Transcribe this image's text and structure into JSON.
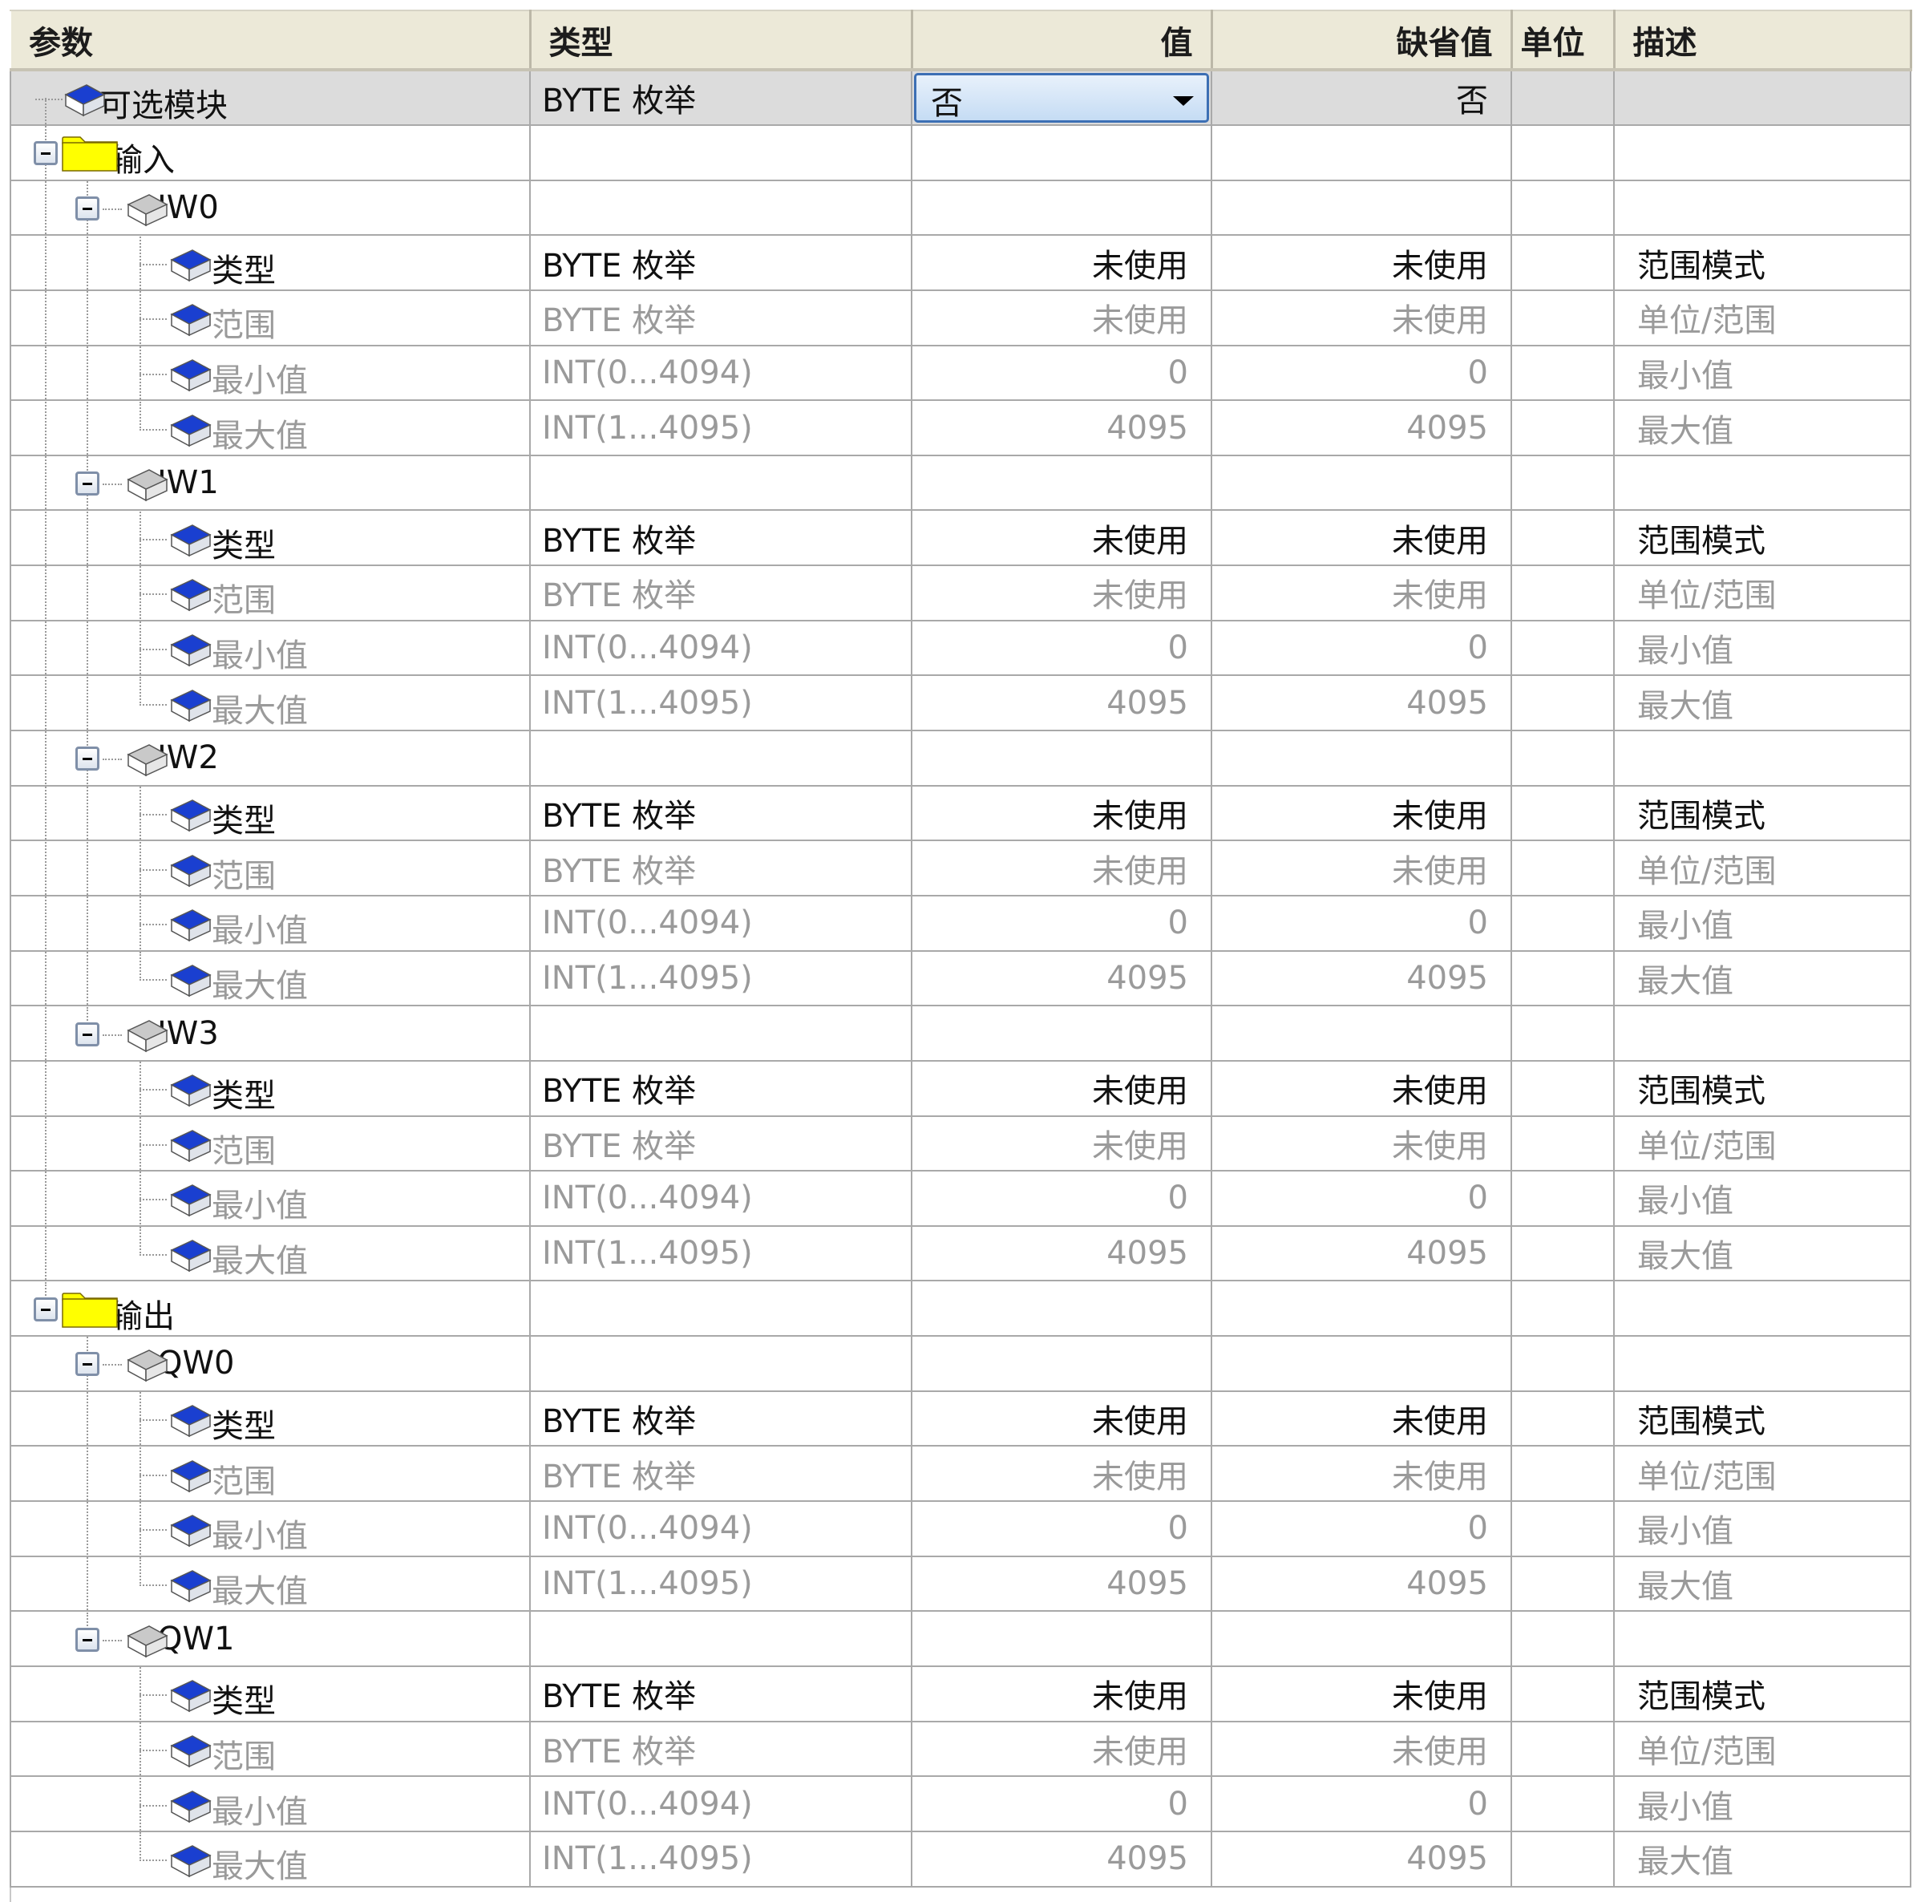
{
  "columns": [
    {
      "label": "参数",
      "align": "left"
    },
    {
      "label": "类型",
      "align": "left"
    },
    {
      "label": "值",
      "align": "right"
    },
    {
      "label": "缺省值",
      "align": "right"
    },
    {
      "label": "单位",
      "align": "left"
    },
    {
      "label": "描述",
      "align": "left"
    }
  ],
  "colors": {
    "header_bg": "#ece9d8",
    "selected_row": "#dcdcdc",
    "disabled_text": "#9a9a9a",
    "dropdown_border": "#3c6fb4",
    "folder": "#ffff00",
    "param_icon": "#1a3fd0"
  },
  "rows": [
    {
      "kind": "param",
      "level": 0,
      "name": "可选模块",
      "type": "BYTE 枚举",
      "value": "否",
      "default": "否",
      "unit": "",
      "desc": "",
      "selected": true,
      "dropdown": true,
      "icon": "blue-block-icon"
    },
    {
      "kind": "folder",
      "level": 0,
      "name": "输入",
      "icon": "folder-icon"
    },
    {
      "kind": "channel",
      "level": 1,
      "name": "IW0",
      "icon": "gray-block-icon"
    },
    {
      "kind": "param",
      "level": 2,
      "name": "类型",
      "type": "BYTE 枚举",
      "value": "未使用",
      "default": "未使用",
      "unit": "",
      "desc": "范围模式",
      "icon": "blue-block-icon"
    },
    {
      "kind": "param",
      "level": 2,
      "name": "范围",
      "type": "BYTE 枚举",
      "value": "未使用",
      "default": "未使用",
      "unit": "",
      "desc": "单位/范围",
      "disabled": true,
      "icon": "blue-block-icon"
    },
    {
      "kind": "param",
      "level": 2,
      "name": "最小值",
      "type": "INT(0...4094)",
      "value": "0",
      "default": "0",
      "unit": "",
      "desc": "最小值",
      "disabled": true,
      "icon": "blue-block-icon"
    },
    {
      "kind": "param",
      "level": 2,
      "name": "最大值",
      "type": "INT(1...4095)",
      "value": "4095",
      "default": "4095",
      "unit": "",
      "desc": "最大值",
      "disabled": true,
      "last": true,
      "icon": "blue-block-icon"
    },
    {
      "kind": "channel",
      "level": 1,
      "name": "IW1",
      "icon": "gray-block-icon"
    },
    {
      "kind": "param",
      "level": 2,
      "name": "类型",
      "type": "BYTE 枚举",
      "value": "未使用",
      "default": "未使用",
      "unit": "",
      "desc": "范围模式",
      "icon": "blue-block-icon"
    },
    {
      "kind": "param",
      "level": 2,
      "name": "范围",
      "type": "BYTE 枚举",
      "value": "未使用",
      "default": "未使用",
      "unit": "",
      "desc": "单位/范围",
      "disabled": true,
      "icon": "blue-block-icon"
    },
    {
      "kind": "param",
      "level": 2,
      "name": "最小值",
      "type": "INT(0...4094)",
      "value": "0",
      "default": "0",
      "unit": "",
      "desc": "最小值",
      "disabled": true,
      "icon": "blue-block-icon"
    },
    {
      "kind": "param",
      "level": 2,
      "name": "最大值",
      "type": "INT(1...4095)",
      "value": "4095",
      "default": "4095",
      "unit": "",
      "desc": "最大值",
      "disabled": true,
      "last": true,
      "icon": "blue-block-icon"
    },
    {
      "kind": "channel",
      "level": 1,
      "name": "IW2",
      "icon": "gray-block-icon"
    },
    {
      "kind": "param",
      "level": 2,
      "name": "类型",
      "type": "BYTE 枚举",
      "value": "未使用",
      "default": "未使用",
      "unit": "",
      "desc": "范围模式",
      "icon": "blue-block-icon"
    },
    {
      "kind": "param",
      "level": 2,
      "name": "范围",
      "type": "BYTE 枚举",
      "value": "未使用",
      "default": "未使用",
      "unit": "",
      "desc": "单位/范围",
      "disabled": true,
      "icon": "blue-block-icon"
    },
    {
      "kind": "param",
      "level": 2,
      "name": "最小值",
      "type": "INT(0...4094)",
      "value": "0",
      "default": "0",
      "unit": "",
      "desc": "最小值",
      "disabled": true,
      "icon": "blue-block-icon"
    },
    {
      "kind": "param",
      "level": 2,
      "name": "最大值",
      "type": "INT(1...4095)",
      "value": "4095",
      "default": "4095",
      "unit": "",
      "desc": "最大值",
      "disabled": true,
      "last": true,
      "icon": "blue-block-icon"
    },
    {
      "kind": "channel",
      "level": 1,
      "name": "IW3",
      "last": true,
      "icon": "gray-block-icon"
    },
    {
      "kind": "param",
      "level": 2,
      "name": "类型",
      "type": "BYTE 枚举",
      "value": "未使用",
      "default": "未使用",
      "unit": "",
      "desc": "范围模式",
      "icon": "blue-block-icon"
    },
    {
      "kind": "param",
      "level": 2,
      "name": "范围",
      "type": "BYTE 枚举",
      "value": "未使用",
      "default": "未使用",
      "unit": "",
      "desc": "单位/范围",
      "disabled": true,
      "icon": "blue-block-icon"
    },
    {
      "kind": "param",
      "level": 2,
      "name": "最小值",
      "type": "INT(0...4094)",
      "value": "0",
      "default": "0",
      "unit": "",
      "desc": "最小值",
      "disabled": true,
      "icon": "blue-block-icon"
    },
    {
      "kind": "param",
      "level": 2,
      "name": "最大值",
      "type": "INT(1...4095)",
      "value": "4095",
      "default": "4095",
      "unit": "",
      "desc": "最大值",
      "disabled": true,
      "last": true,
      "icon": "blue-block-icon"
    },
    {
      "kind": "folder",
      "level": 0,
      "name": "输出",
      "icon": "folder-icon"
    },
    {
      "kind": "channel",
      "level": 1,
      "name": "QW0",
      "icon": "gray-block-icon"
    },
    {
      "kind": "param",
      "level": 2,
      "name": "类型",
      "type": "BYTE 枚举",
      "value": "未使用",
      "default": "未使用",
      "unit": "",
      "desc": "范围模式",
      "icon": "blue-block-icon"
    },
    {
      "kind": "param",
      "level": 2,
      "name": "范围",
      "type": "BYTE 枚举",
      "value": "未使用",
      "default": "未使用",
      "unit": "",
      "desc": "单位/范围",
      "disabled": true,
      "icon": "blue-block-icon"
    },
    {
      "kind": "param",
      "level": 2,
      "name": "最小值",
      "type": "INT(0...4094)",
      "value": "0",
      "default": "0",
      "unit": "",
      "desc": "最小值",
      "disabled": true,
      "icon": "blue-block-icon"
    },
    {
      "kind": "param",
      "level": 2,
      "name": "最大值",
      "type": "INT(1...4095)",
      "value": "4095",
      "default": "4095",
      "unit": "",
      "desc": "最大值",
      "disabled": true,
      "last": true,
      "icon": "blue-block-icon"
    },
    {
      "kind": "channel",
      "level": 1,
      "name": "QW1",
      "last": true,
      "icon": "gray-block-icon"
    },
    {
      "kind": "param",
      "level": 2,
      "name": "类型",
      "type": "BYTE 枚举",
      "value": "未使用",
      "default": "未使用",
      "unit": "",
      "desc": "范围模式",
      "icon": "blue-block-icon"
    },
    {
      "kind": "param",
      "level": 2,
      "name": "范围",
      "type": "BYTE 枚举",
      "value": "未使用",
      "default": "未使用",
      "unit": "",
      "desc": "单位/范围",
      "disabled": true,
      "icon": "blue-block-icon"
    },
    {
      "kind": "param",
      "level": 2,
      "name": "最小值",
      "type": "INT(0...4094)",
      "value": "0",
      "default": "0",
      "unit": "",
      "desc": "最小值",
      "disabled": true,
      "icon": "blue-block-icon"
    },
    {
      "kind": "param",
      "level": 2,
      "name": "最大值",
      "type": "INT(1...4095)",
      "value": "4095",
      "default": "4095",
      "unit": "",
      "desc": "最大值",
      "disabled": true,
      "last": true,
      "icon": "blue-block-icon"
    }
  ]
}
